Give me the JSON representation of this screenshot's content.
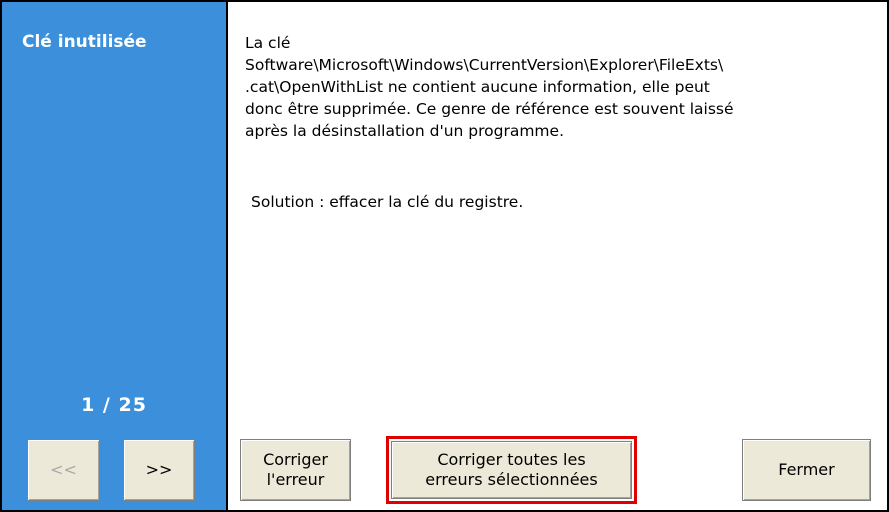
{
  "sidebar": {
    "title": "Clé inutilisée",
    "counter": "1 / 25",
    "background_color": "#3b8fdb"
  },
  "message": {
    "lines": [
      "La clé",
      "Software\\Microsoft\\Windows\\CurrentVersion\\Explorer\\FileExts\\",
      ".cat\\OpenWithList ne contient aucune information, elle peut",
      "donc être supprimée. Ce genre de référence est souvent laissé",
      "après la désinstallation d'un programme."
    ],
    "solution": "Solution : effacer la clé du registre."
  },
  "buttons": {
    "prev_label": "<<",
    "next_label": ">>",
    "fix_label_line1": "Corriger",
    "fix_label_line2": "l'erreur",
    "fix_all_label_line1": "Corriger toutes les",
    "fix_all_label_line2": "erreurs sélectionnées",
    "close_label": "Fermer",
    "highlight_color": "#e00000"
  }
}
